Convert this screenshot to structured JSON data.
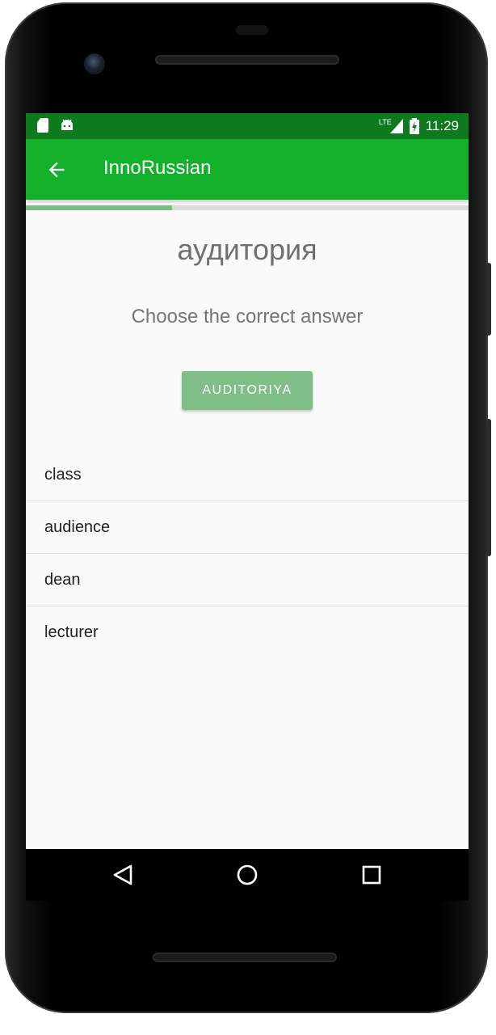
{
  "status_bar": {
    "time": "11:29",
    "network": "LTE",
    "left_icons": [
      "sd-card-icon",
      "android-icon"
    ],
    "right_icons": [
      "signal-icon",
      "battery-charging-icon"
    ]
  },
  "app_bar": {
    "title": "InnoRussian",
    "back_icon": "back-arrow-icon",
    "color": "#12b02b",
    "status_color": "#0d7a1e"
  },
  "progress": {
    "fraction": 0.33,
    "fill_color": "#7cbd83"
  },
  "question": {
    "word": "аудитория",
    "instruction": "Choose the correct answer",
    "transliteration_button": "AUDITORIYA"
  },
  "options": [
    {
      "label": "class"
    },
    {
      "label": "audience"
    },
    {
      "label": "dean"
    },
    {
      "label": "lecturer"
    }
  ],
  "nav_bar": {
    "icons": [
      "back-triangle-icon",
      "home-circle-icon",
      "recents-square-icon"
    ]
  }
}
